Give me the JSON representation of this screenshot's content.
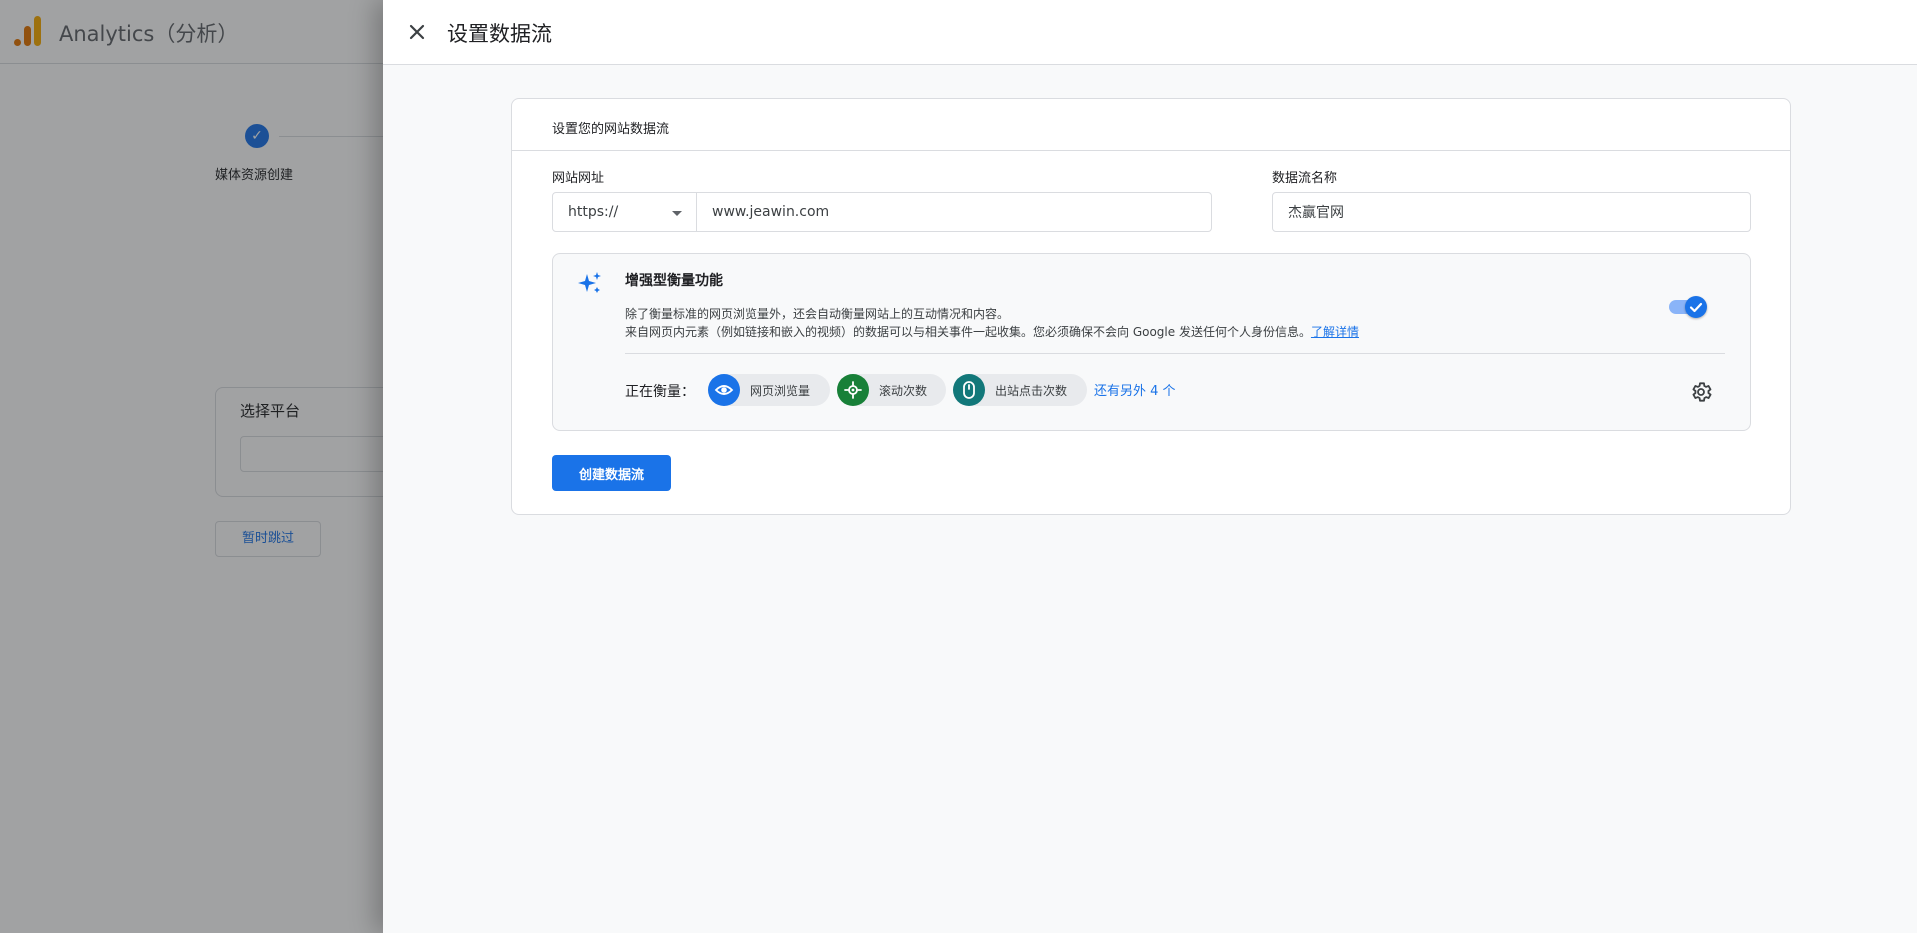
{
  "background": {
    "app_title": "Analytics（分析）",
    "step_check": "✓",
    "step_label": "媒体资源创建",
    "platform_title": "选择平台",
    "skip_label": "暂时跳过"
  },
  "drawer": {
    "close_glyph": "✕",
    "title": "设置数据流"
  },
  "card": {
    "heading": "设置您的网站数据流",
    "website_url_label": "网站网址",
    "protocol_value": "https://",
    "url_value": "www.jeawin.com",
    "stream_name_label": "数据流名称",
    "stream_name_value": "杰赢官网"
  },
  "enhanced": {
    "icon": "sparkle-icon",
    "title": "增强型衡量功能",
    "desc_line1": "除了衡量标准的网页浏览量外，还会自动衡量网站上的互动情况和内容。",
    "desc_line2": "来自网页内元素（例如链接和嵌入的视频）的数据可以与相关事件一起收集。您必须确保不会向 Google 发送任何个人身份信息。",
    "learn_more": "了解详情",
    "toggle_on": true,
    "measuring_label": "正在衡量：",
    "chips": [
      {
        "label": "网页浏览量",
        "icon": "eye-icon",
        "color": "#1a73e8"
      },
      {
        "label": "滚动次数",
        "icon": "crosshair-icon",
        "color": "#188038"
      },
      {
        "label": "出站点击次数",
        "icon": "mouse-icon",
        "color": "#12787a"
      }
    ],
    "more_link": "还有另外 4 个"
  },
  "actions": {
    "create_label": "创建数据流"
  },
  "colors": {
    "accent": "#1a73e8",
    "scrim": "rgba(32,33,36,0.42)"
  }
}
